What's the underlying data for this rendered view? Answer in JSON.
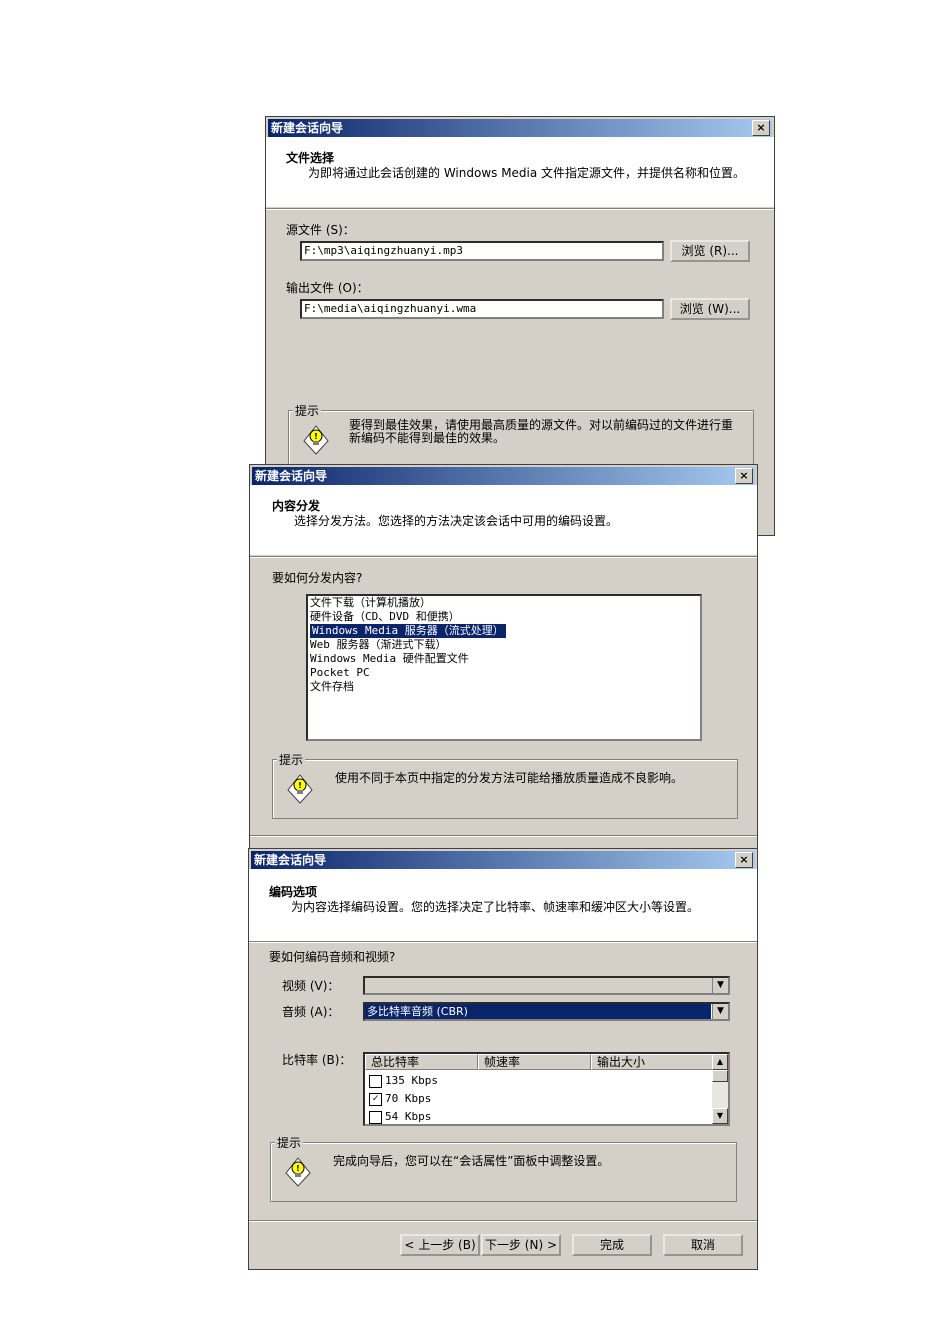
{
  "dialog1": {
    "title": "新建会话向导",
    "close": "×",
    "header_title": "文件选择",
    "header_sub": "为即将通过此会话创建的 Windows Media 文件指定源文件，并提供名称和位置。",
    "source_label": "源文件 (S)：",
    "source_value": "F:\\mp3\\aiqingzhuanyi.mp3",
    "browse_source": "浏览 (R)...",
    "output_label": "输出文件 (O)：",
    "output_value": "F:\\media\\aiqingzhuanyi.wma",
    "browse_output": "浏览 (W)...",
    "hint_legend": "提示",
    "hint_text": "要得到最佳效果，请使用最高质量的源文件。对以前编码过的文件进行重新编码不能得到最佳的效果。"
  },
  "dialog2": {
    "title": "新建会话向导",
    "close": "×",
    "header_title": "内容分发",
    "header_sub": "选择分发方法。您选择的方法决定该会话中可用的编码设置。",
    "question": "要如何分发内容?",
    "options": [
      "文件下载（计算机播放）",
      "硬件设备（CD、DVD 和便携）",
      "Windows Media 服务器（流式处理）",
      "Web 服务器（渐进式下载）",
      "Windows Media 硬件配置文件",
      "Pocket PC",
      "文件存档"
    ],
    "selected_index": 2,
    "hint_legend": "提示",
    "hint_text": "使用不同于本页中指定的分发方法可能给播放质量造成不良影响。"
  },
  "dialog3": {
    "title": "新建会话向导",
    "close": "×",
    "header_title": "编码选项",
    "header_sub": "为内容选择编码设置。您的选择决定了比特率、帧速率和缓冲区大小等设置。",
    "question": "要如何编码音频和视频?",
    "video_label": "视频 (V)：",
    "video_value": "",
    "audio_label": "音频 (A)：",
    "audio_value": "多比特率音频 (CBR)",
    "bitrate_label": "比特率 (B)：",
    "columns": [
      "总比特率",
      "帧速率",
      "输出大小"
    ],
    "rows": [
      {
        "label": "135 Kbps",
        "checked": false
      },
      {
        "label": "70 Kbps",
        "checked": true
      },
      {
        "label": "54 Kbps",
        "checked": false
      }
    ],
    "hint_legend": "提示",
    "hint_text": "完成向导后，您可以在“会话属性”面板中调整设置。",
    "back_button": "< 上一步 (B)",
    "next_button": "下一步 (N) >",
    "finish_button": "完成",
    "cancel_button": "取消"
  }
}
